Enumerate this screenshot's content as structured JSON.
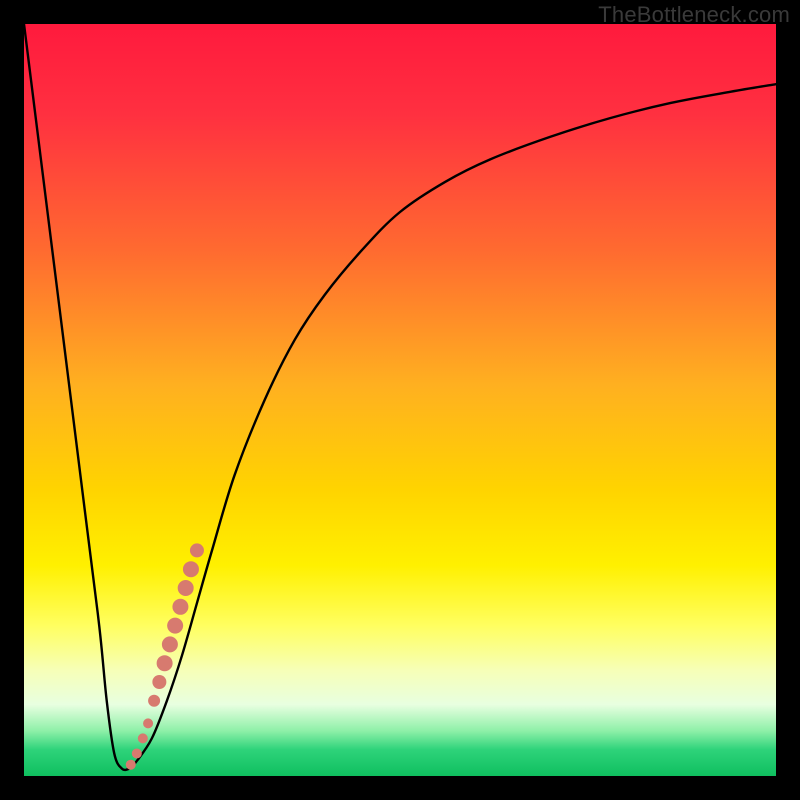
{
  "attribution": "TheBottleneck.com",
  "colors": {
    "frame": "#000000",
    "curve": "#000000",
    "dots": "#d77a6f",
    "gradient_stops": [
      {
        "offset": 0.0,
        "color": "#ff1a3d"
      },
      {
        "offset": 0.12,
        "color": "#ff3040"
      },
      {
        "offset": 0.3,
        "color": "#ff6a30"
      },
      {
        "offset": 0.48,
        "color": "#ffb020"
      },
      {
        "offset": 0.62,
        "color": "#ffd400"
      },
      {
        "offset": 0.72,
        "color": "#fff000"
      },
      {
        "offset": 0.8,
        "color": "#ffff60"
      },
      {
        "offset": 0.86,
        "color": "#f6ffb8"
      },
      {
        "offset": 0.905,
        "color": "#e8ffe0"
      },
      {
        "offset": 0.94,
        "color": "#8ef0a8"
      },
      {
        "offset": 0.965,
        "color": "#2ed37a"
      },
      {
        "offset": 1.0,
        "color": "#0fbf5f"
      }
    ]
  },
  "chart_data": {
    "type": "line",
    "title": "",
    "xlabel": "",
    "ylabel": "",
    "xlim": [
      0,
      100
    ],
    "ylim": [
      0,
      100
    ],
    "series": [
      {
        "name": "bottleneck-curve",
        "x": [
          0,
          4,
          8,
          10,
          11,
          12,
          13,
          14,
          15,
          17,
          19,
          21,
          23,
          25,
          28,
          32,
          36,
          40,
          45,
          50,
          56,
          62,
          70,
          78,
          86,
          94,
          100
        ],
        "y": [
          100,
          68,
          36,
          20,
          10,
          3,
          1,
          1,
          2,
          5,
          10,
          16,
          23,
          30,
          40,
          50,
          58,
          64,
          70,
          75,
          79,
          82,
          85,
          87.5,
          89.5,
          91,
          92
        ]
      }
    ],
    "annotations": {
      "dots": {
        "name": "highlighted-points",
        "color": "#d77a6f",
        "points": [
          {
            "x": 14.2,
            "y": 1.5,
            "r": 5
          },
          {
            "x": 15.0,
            "y": 3.0,
            "r": 5
          },
          {
            "x": 15.8,
            "y": 5.0,
            "r": 5
          },
          {
            "x": 16.5,
            "y": 7.0,
            "r": 5
          },
          {
            "x": 17.3,
            "y": 10.0,
            "r": 6
          },
          {
            "x": 18.0,
            "y": 12.5,
            "r": 7
          },
          {
            "x": 18.7,
            "y": 15.0,
            "r": 8
          },
          {
            "x": 19.4,
            "y": 17.5,
            "r": 8
          },
          {
            "x": 20.1,
            "y": 20.0,
            "r": 8
          },
          {
            "x": 20.8,
            "y": 22.5,
            "r": 8
          },
          {
            "x": 21.5,
            "y": 25.0,
            "r": 8
          },
          {
            "x": 22.2,
            "y": 27.5,
            "r": 8
          },
          {
            "x": 23.0,
            "y": 30.0,
            "r": 7
          }
        ]
      }
    }
  }
}
